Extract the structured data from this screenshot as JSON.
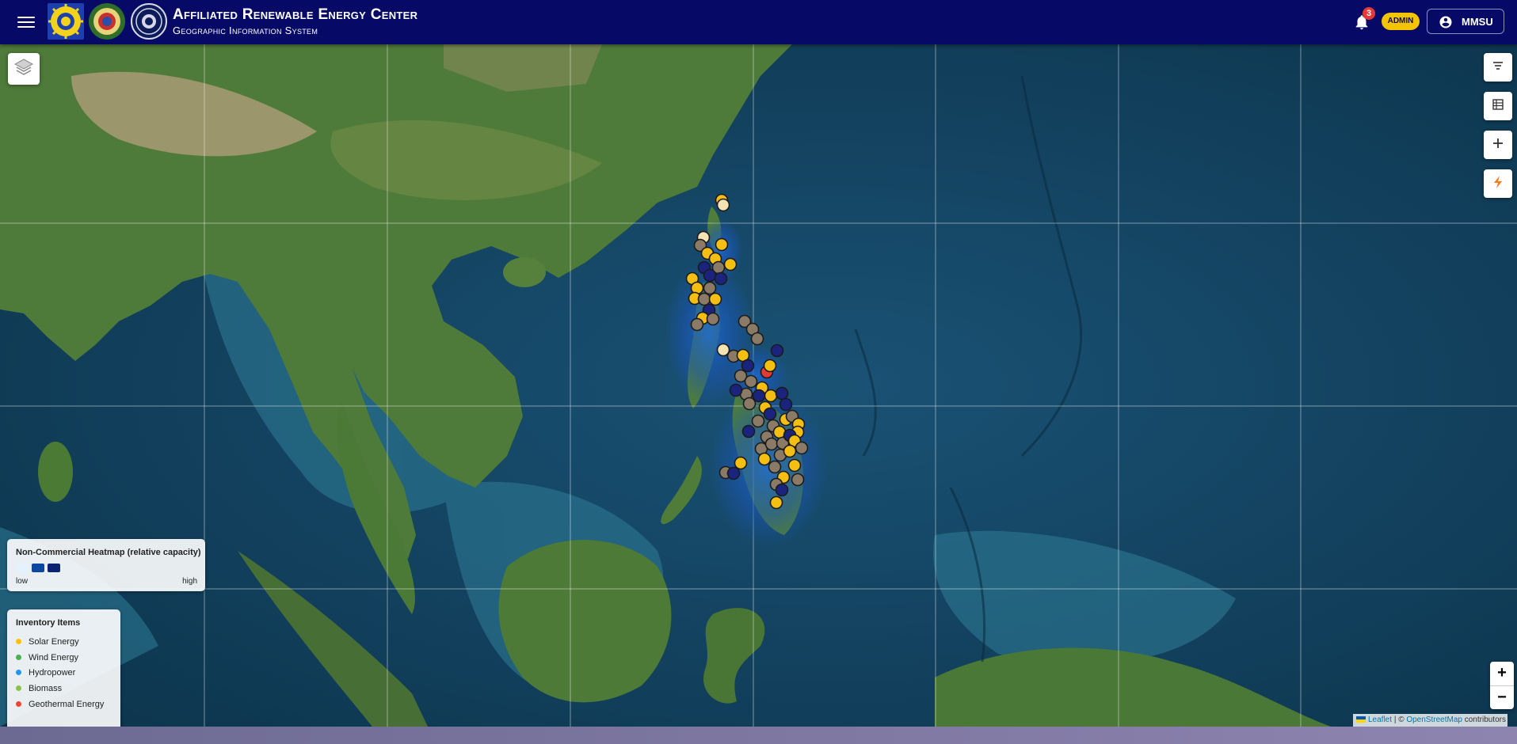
{
  "header": {
    "title": "Affiliated Renewable Energy Center",
    "subtitle": "Geographic Information System",
    "notification_count": "3",
    "role_badge": "ADMIN",
    "user_label": "MMSU",
    "icons": [
      "menu-icon",
      "seal-logo",
      "university-logo",
      "institute-logo",
      "bell-icon",
      "account-circle-icon"
    ]
  },
  "map": {
    "layer_control_icon": "layers-icon",
    "right_controls": [
      "filter-icon",
      "table-icon",
      "add-icon",
      "lightning-icon"
    ],
    "zoom_in_label": "+",
    "zoom_out_label": "−",
    "attribution": {
      "leaflet": "Leaflet",
      "separator": "| ©",
      "osm": "OpenStreetMap",
      "suffix": "contributors"
    }
  },
  "heatmap_legend": {
    "title": "Non-Commercial Heatmap (relative capacity)",
    "low_label": "low",
    "high_label": "high",
    "colors": [
      "#e3f2fd",
      "#0d47a1",
      "#0a2472"
    ]
  },
  "inventory_legend": {
    "title": "Inventory Items",
    "items": [
      {
        "label": "Solar Energy",
        "color": "#ffc107"
      },
      {
        "label": "Wind Energy",
        "color": "#4caf50"
      },
      {
        "label": "Hydropower",
        "color": "#2196f3"
      },
      {
        "label": "Biomass",
        "color": "#8bc34a"
      },
      {
        "label": "Geothermal Energy",
        "color": "#f44336"
      }
    ]
  },
  "marker_colors": {
    "solar": "#f5be12",
    "hydro": "#1a237e",
    "geothermal": "#e53935",
    "other": "#8a7a66",
    "highlight": "#f6e3b4"
  }
}
